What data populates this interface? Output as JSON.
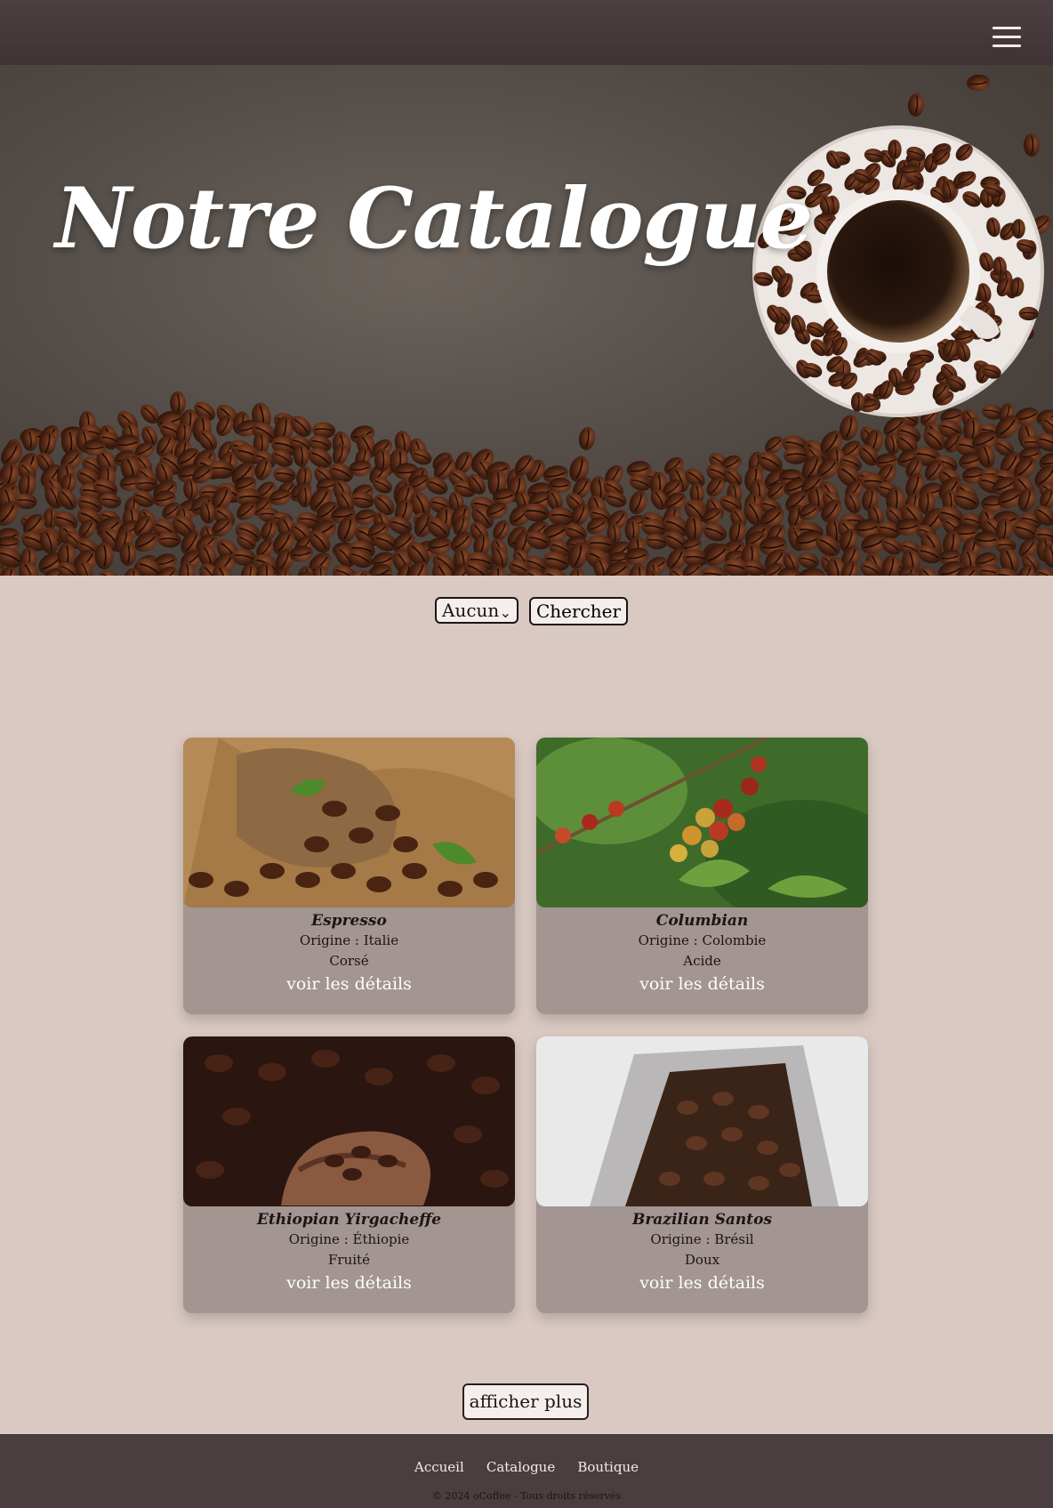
{
  "header": {
    "menu_icon": "hamburger-menu-icon"
  },
  "hero": {
    "title": "Notre Catalogue"
  },
  "filter": {
    "select_value": "Aucun",
    "search_label": "Chercher"
  },
  "products": [
    {
      "name": "Espresso",
      "origin": "Origine : Italie",
      "note": "Corsé",
      "details": "voir les détails"
    },
    {
      "name": "Columbian",
      "origin": "Origine : Colombie",
      "note": "Acide",
      "details": "voir les détails"
    },
    {
      "name": "Ethiopian Yirgacheffe",
      "origin": "Origine : Éthiopie",
      "note": "Fruité",
      "details": "voir les détails"
    },
    {
      "name": "Brazilian Santos",
      "origin": "Origine : Brésil",
      "note": "Doux",
      "details": "voir les détails"
    }
  ],
  "more_label": "afficher plus",
  "footer": {
    "links": [
      "Accueil",
      "Catalogue",
      "Boutique"
    ],
    "copyright": "© 2024 oCoffee - Tous droits réservés"
  },
  "colors": {
    "header": "#4d4042",
    "page": "#d9c9c2",
    "card": "#a29592",
    "footer": "#4b3e40"
  }
}
